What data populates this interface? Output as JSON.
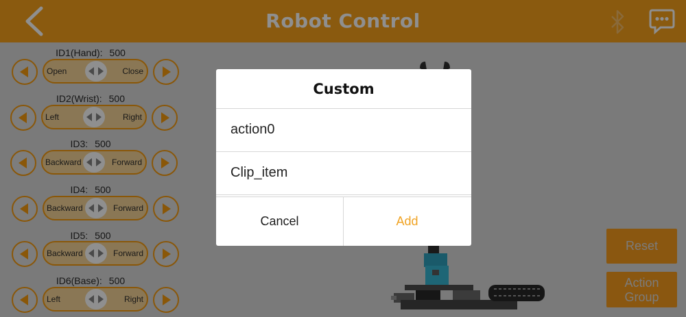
{
  "header": {
    "title": "Robot Control",
    "back_icon": "back-chevron-icon",
    "bluetooth_icon": "bluetooth-icon",
    "chat_icon": "chat-bubble-icon"
  },
  "controls": [
    {
      "label": "ID1(Hand):",
      "value": "500",
      "left": "Open",
      "right": "Close"
    },
    {
      "label": "ID2(Wrist):",
      "value": "500",
      "left": "Left",
      "right": "Right"
    },
    {
      "label": "ID3:",
      "value": "500",
      "left": "Backward",
      "right": "Forward"
    },
    {
      "label": "ID4:",
      "value": "500",
      "left": "Backward",
      "right": "Forward"
    },
    {
      "label": "ID5:",
      "value": "500",
      "left": "Backward",
      "right": "Forward"
    },
    {
      "label": "ID6(Base):",
      "value": "500",
      "left": "Left",
      "right": "Right"
    }
  ],
  "side_buttons": {
    "reset": "Reset",
    "action_group_line1": "Action",
    "action_group_line2": "Group"
  },
  "dialog": {
    "title": "Custom",
    "items": [
      "action0",
      "Clip_item"
    ],
    "cancel": "Cancel",
    "add": "Add"
  },
  "colors": {
    "accent": "#f0a323",
    "header_dimmed": "#8a5a0f",
    "overlay_background": "#7a7a7a",
    "dialog_background": "#ffffff"
  }
}
